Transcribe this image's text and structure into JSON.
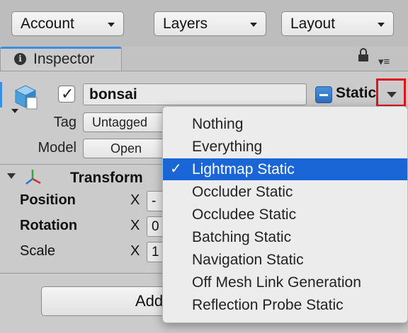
{
  "toolbar": {
    "account": "Account",
    "layers": "Layers",
    "layout": "Layout"
  },
  "tab": {
    "title": "Inspector",
    "info_icon": "info-icon",
    "lock_icon": "lock-icon",
    "menu_icon": "list-menu-icon"
  },
  "gameobject": {
    "name": "bonsai",
    "active": true,
    "static_label": "Static",
    "tag_label": "Tag",
    "tag_value": "Untagged",
    "model_label": "Model",
    "model_button": "Open"
  },
  "transform": {
    "title": "Transform",
    "position_label": "Position",
    "rotation_label": "Rotation",
    "scale_label": "Scale",
    "axis_x": "X",
    "position_x": "-",
    "rotation_x": "0",
    "scale_x": "1"
  },
  "add_component": {
    "label": "Add"
  },
  "static_menu": {
    "items": [
      {
        "label": "Nothing",
        "checked": false
      },
      {
        "label": "Everything",
        "checked": false
      },
      {
        "label": "Lightmap Static",
        "checked": true
      },
      {
        "label": "Occluder Static",
        "checked": false
      },
      {
        "label": "Occludee Static",
        "checked": false
      },
      {
        "label": "Batching Static",
        "checked": false
      },
      {
        "label": "Navigation Static",
        "checked": false
      },
      {
        "label": "Off Mesh Link Generation",
        "checked": false
      },
      {
        "label": "Reflection Probe Static",
        "checked": false
      }
    ],
    "check_glyph": "✓"
  },
  "colors": {
    "accent": "#1a66d6",
    "highlight_box": "#e0141c",
    "panel_bg": "#cbcbcb"
  }
}
